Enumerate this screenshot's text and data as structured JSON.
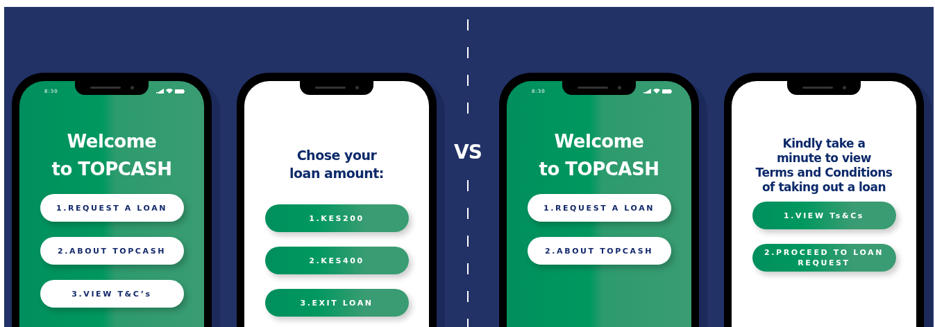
{
  "phones": [
    {
      "kind": "home",
      "status_time": "8:30",
      "heading": [
        "Welcome",
        "to TOPCASH"
      ],
      "buttons": [
        "1.REQUEST A LOAN",
        "2.ABOUT TOPCASH",
        "3.VIEW T&C’s"
      ]
    },
    {
      "kind": "prompt",
      "heading": [
        "Chose your",
        "loan amount:"
      ],
      "buttons": [
        "1.KES200",
        "2.KES400",
        "3.EXIT LOAN"
      ]
    }
  ],
  "divider_label": "VS",
  "phones_right": [
    {
      "kind": "home",
      "status_time": "8:30",
      "heading": [
        "Welcome",
        "to TOPCASH"
      ],
      "buttons": [
        "1.REQUEST A LOAN",
        "2.ABOUT TOPCASH"
      ]
    },
    {
      "kind": "prompt",
      "heading": [
        "Kindly take a",
        "minute to view",
        "Terms and Conditions",
        "of taking out a loan"
      ],
      "buttons": [
        "1.VIEW Ts&Cs",
        "2.PROCEED TO LOAN REQUEST"
      ]
    }
  ]
}
